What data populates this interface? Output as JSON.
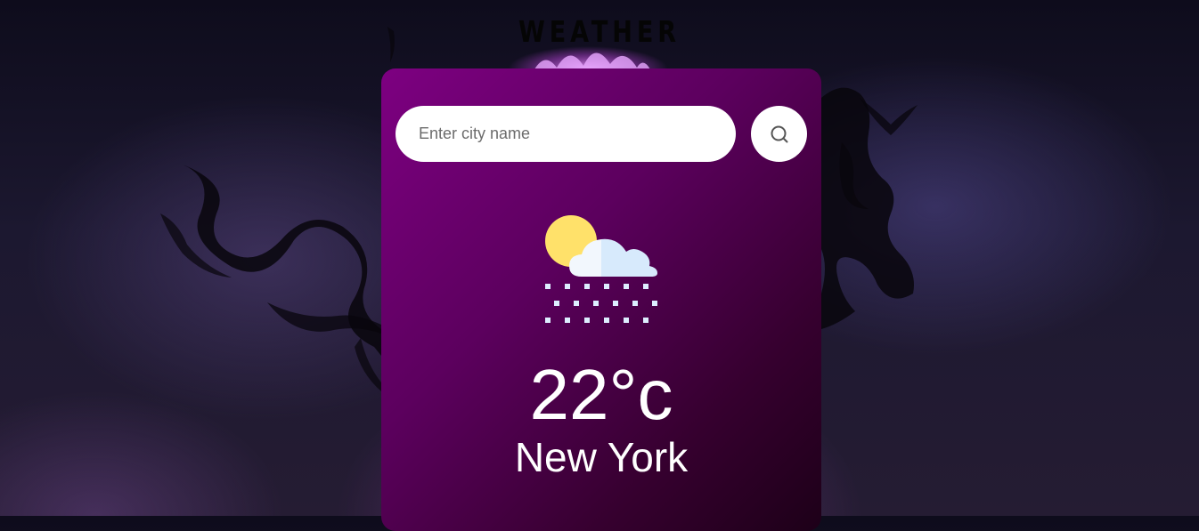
{
  "page": {
    "title": "WEATHER"
  },
  "search": {
    "placeholder": "Enter city name",
    "value": "",
    "button_icon": "search-icon"
  },
  "weather": {
    "icon": "sun-cloud-snow-icon",
    "temperature": "22°c",
    "city": "New York"
  },
  "colors": {
    "card_top": "#7d0081",
    "card_bottom": "#1d0018",
    "sun": "#ffe16a",
    "cloud": "#ddeeff"
  }
}
